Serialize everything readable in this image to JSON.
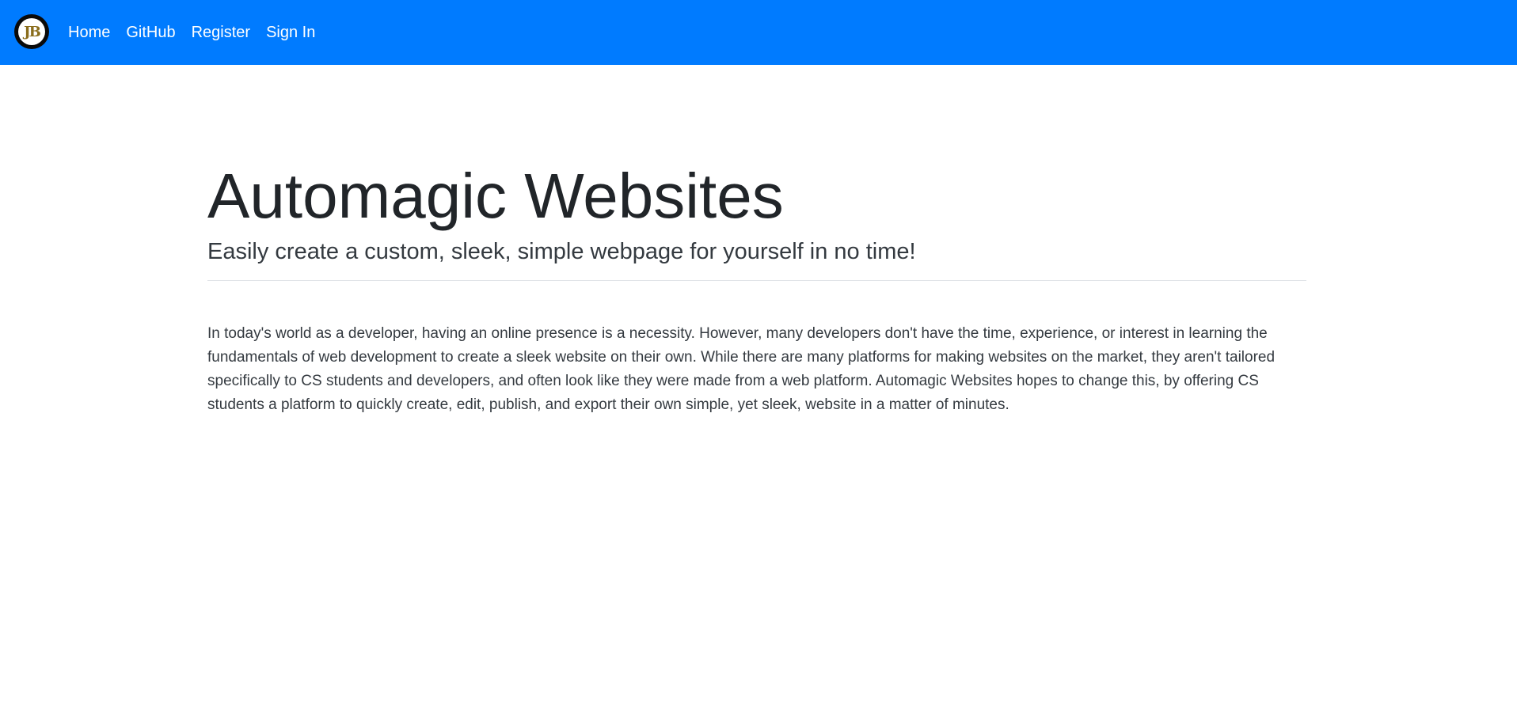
{
  "navbar": {
    "logo_text": "JB",
    "links": [
      {
        "label": "Home"
      },
      {
        "label": "GitHub"
      },
      {
        "label": "Register"
      },
      {
        "label": "Sign In"
      }
    ],
    "background_color": "#007bff"
  },
  "hero": {
    "title": "Automagic Websites",
    "subtitle": "Easily create a custom, sleek, simple webpage for yourself in no time!",
    "description": "In today's world as a developer, having an online presence is a necessity. However, many developers don't have the time, experience, or interest in learning the fundamentals of web development to create a sleek website on their own. While there are many platforms for making websites on the market, they aren't tailored specifically to CS students and developers, and often look like they were made from a web platform. Automagic Websites hopes to change this, by offering CS students a platform to quickly create, edit, publish, and export their own simple, yet sleek, website in a matter of minutes."
  }
}
